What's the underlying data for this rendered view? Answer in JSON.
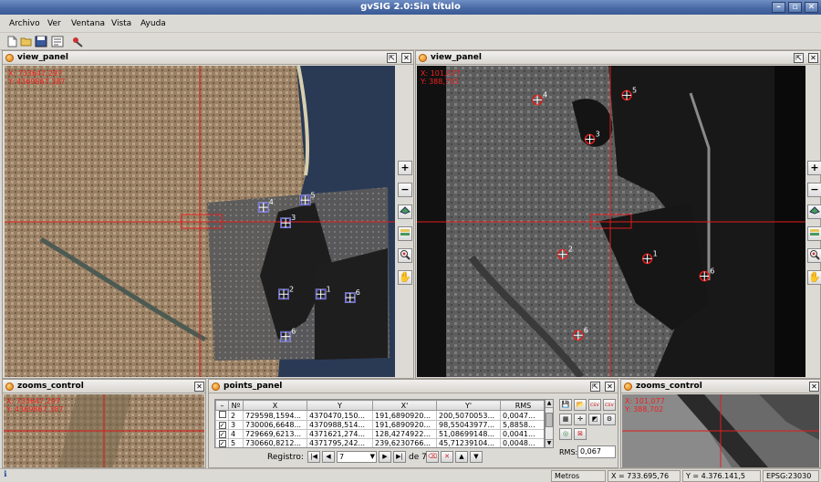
{
  "window": {
    "title": "gvSIG 2.0:Sin título"
  },
  "menu": [
    "Archivo",
    "Ver",
    "Ventana",
    "Vista",
    "Ayuda"
  ],
  "toolbar_icons": [
    "new-document-icon",
    "open-folder-icon",
    "save-icon",
    "properties-icon",
    "tools-icon"
  ],
  "left_view": {
    "title": "view_panel",
    "coord_x": "X: 733647,297",
    "coord_y": "Y: 4369867,387",
    "points": [
      {
        "label": "4",
        "fx": 0.663,
        "fy": 0.455
      },
      {
        "label": "5",
        "fx": 0.77,
        "fy": 0.432
      },
      {
        "label": "3",
        "fx": 0.72,
        "fy": 0.505
      },
      {
        "label": "2",
        "fx": 0.715,
        "fy": 0.734
      },
      {
        "label": "1",
        "fx": 0.81,
        "fy": 0.734
      },
      {
        "label": "6",
        "fx": 0.885,
        "fy": 0.745
      },
      {
        "label": "6",
        "fx": 0.72,
        "fy": 0.87
      }
    ]
  },
  "right_view": {
    "title": "view_panel",
    "coord_x": "X: 101,077",
    "coord_y": "Y: 388,702",
    "points": [
      {
        "label": "4",
        "fx": 0.31,
        "fy": 0.11
      },
      {
        "label": "5",
        "fx": 0.54,
        "fy": 0.095
      },
      {
        "label": "3",
        "fx": 0.445,
        "fy": 0.236
      },
      {
        "label": "2",
        "fx": 0.375,
        "fy": 0.606
      },
      {
        "label": "1",
        "fx": 0.593,
        "fy": 0.62
      },
      {
        "label": "6",
        "fx": 0.74,
        "fy": 0.676
      },
      {
        "label": "6",
        "fx": 0.415,
        "fy": 0.866
      }
    ]
  },
  "side_controls": [
    "zoom-in-button",
    "zoom-out-button",
    "layer-visibility-button",
    "layers-button",
    "zoom-tool-button",
    "pan-tool-button"
  ],
  "zooms_left": {
    "title": "zooms_control",
    "coord_x": "X: 733647,297",
    "coord_y": "Y: 4369867,387"
  },
  "zooms_right": {
    "title": "zooms_control",
    "coord_x": "X: 101,077",
    "coord_y": "Y: 388,702"
  },
  "points_panel": {
    "title": "points_panel",
    "headers": [
      "",
      "Nº",
      "X",
      "Y",
      "X'",
      "Y'",
      "RMS"
    ],
    "rows": [
      [
        "",
        "2",
        "729598,1594...",
        "4370470,150...",
        "191,6890920...",
        "200,5070053...",
        "0,0047..."
      ],
      [
        "✓",
        "3",
        "730006,6648...",
        "4370988,514...",
        "191,6890920...",
        "98,55043977...",
        "5,8858..."
      ],
      [
        "✓",
        "4",
        "729669,6213...",
        "4371621,274...",
        "128,4274922...",
        "51,08699148...",
        "0,0041..."
      ],
      [
        "✓",
        "5",
        "730660,8212...",
        "4371795,242...",
        "239,6230766...",
        "45,71239104...",
        "0,0048..."
      ]
    ],
    "registro_label": "Registro:",
    "registro_value": "7",
    "registro_total": "de 7",
    "rms_label": "RMS:",
    "rms_value": "0,067"
  },
  "status": {
    "units": "Metros",
    "x": "X = 733.695,76",
    "y": "Y = 4.376.141,5",
    "epsg": "EPSG:23030"
  },
  "colors": {
    "marker_left": "#3b3bd6",
    "marker_right": "#e21c1c",
    "crosshair": "#e21c1c"
  }
}
